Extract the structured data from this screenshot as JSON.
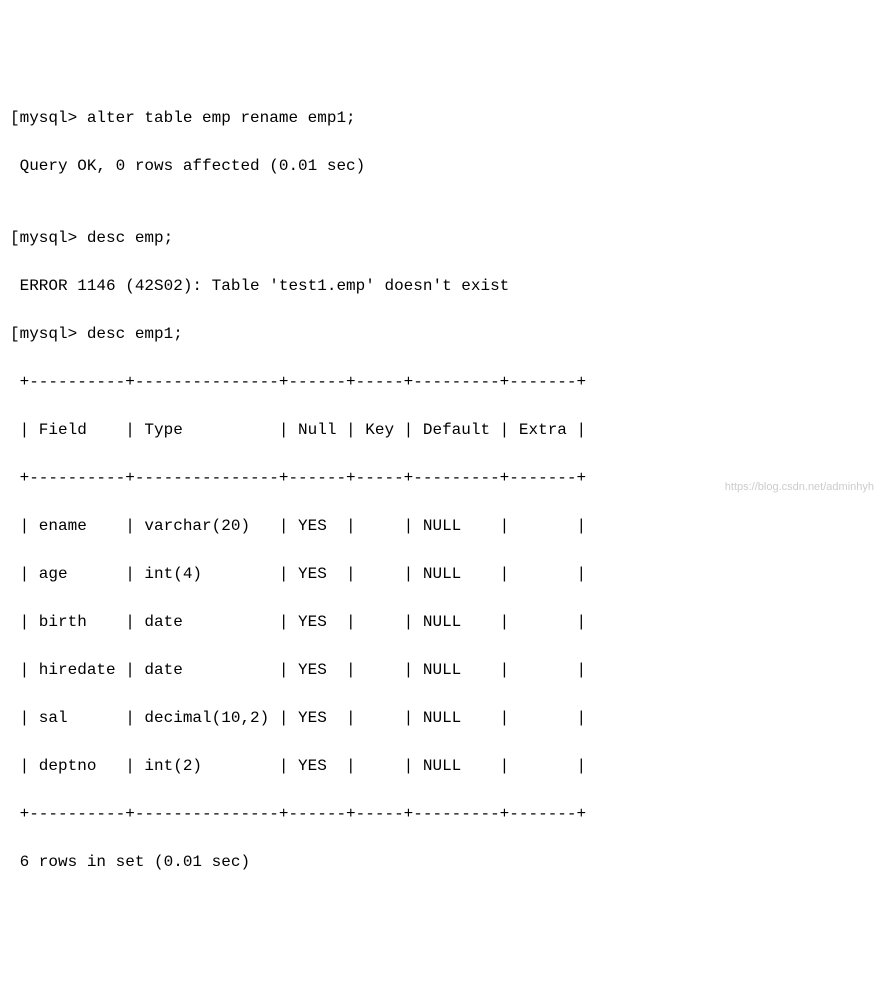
{
  "lines": {
    "l0": "[mysql> alter table emp rename emp1;",
    "l1": " Query OK, 0 rows affected (0.01 sec)",
    "l2": "",
    "l3": "[mysql> desc emp;",
    "l4": " ERROR 1146 (42S02): Table 'test1.emp' doesn't exist",
    "l5": "[mysql> desc emp1;"
  },
  "table": {
    "border": " +----------+---------------+------+-----+---------+-------+",
    "header": " | Field    | Type          | Null | Key | Default | Extra |",
    "r0": " | ename    | varchar(20)   | YES  |     | NULL    |       |",
    "r1": " | age      | int(4)        | YES  |     | NULL    |       |",
    "r2": " | birth    | date          | YES  |     | NULL    |       |",
    "r3": " | hiredate | date          | YES  |     | NULL    |       |",
    "r4": " | sal      | decimal(10,2) | YES  |     | NULL    |       |",
    "r5": " | deptno   | int(2)        | YES  |     | NULL    |       |"
  },
  "footer": " 6 rows in set (0.01 sec)",
  "watermark": "https://blog.csdn.net/adminhyh",
  "chart_data": {
    "type": "table",
    "title": "desc emp1",
    "columns": [
      "Field",
      "Type",
      "Null",
      "Key",
      "Default",
      "Extra"
    ],
    "rows": [
      {
        "Field": "ename",
        "Type": "varchar(20)",
        "Null": "YES",
        "Key": "",
        "Default": "NULL",
        "Extra": ""
      },
      {
        "Field": "age",
        "Type": "int(4)",
        "Null": "YES",
        "Key": "",
        "Default": "NULL",
        "Extra": ""
      },
      {
        "Field": "birth",
        "Type": "date",
        "Null": "YES",
        "Key": "",
        "Default": "NULL",
        "Extra": ""
      },
      {
        "Field": "hiredate",
        "Type": "date",
        "Null": "YES",
        "Key": "",
        "Default": "NULL",
        "Extra": ""
      },
      {
        "Field": "sal",
        "Type": "decimal(10,2)",
        "Null": "YES",
        "Key": "",
        "Default": "NULL",
        "Extra": ""
      },
      {
        "Field": "deptno",
        "Type": "int(2)",
        "Null": "YES",
        "Key": "",
        "Default": "NULL",
        "Extra": ""
      }
    ],
    "summary": "6 rows in set (0.01 sec)"
  }
}
